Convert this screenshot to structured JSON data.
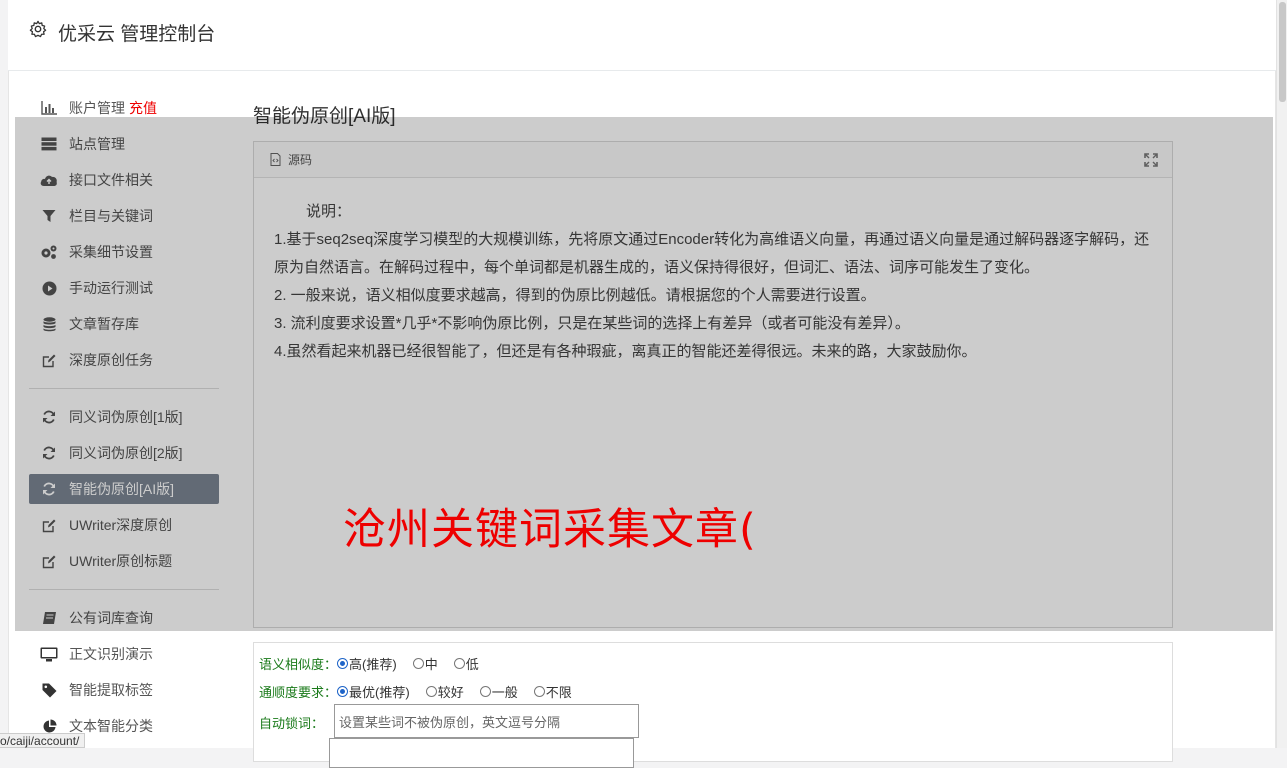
{
  "header": {
    "title": "优采云 管理控制台"
  },
  "sidebar": {
    "group1": [
      {
        "label": "账户管理",
        "badge": "充值",
        "icon": "bar-chart-icon"
      },
      {
        "label": "站点管理",
        "icon": "server-icon"
      },
      {
        "label": "接口文件相关",
        "icon": "cloud-upload-icon"
      },
      {
        "label": "栏目与关键词",
        "icon": "filter-icon"
      },
      {
        "label": "采集细节设置",
        "icon": "gears-icon"
      },
      {
        "label": "手动运行测试",
        "icon": "play-icon"
      },
      {
        "label": "文章暂存库",
        "icon": "database-icon"
      },
      {
        "label": "深度原创任务",
        "icon": "edit-icon"
      }
    ],
    "group2": [
      {
        "label": "同义词伪原创[1版]",
        "icon": "refresh-icon"
      },
      {
        "label": "同义词伪原创[2版]",
        "icon": "refresh-icon"
      },
      {
        "label": "智能伪原创[AI版]",
        "icon": "refresh-icon"
      },
      {
        "label": "UWriter深度原创",
        "icon": "edit-icon"
      },
      {
        "label": "UWriter原创标题",
        "icon": "edit-icon"
      }
    ],
    "group3": [
      {
        "label": "公有词库查询",
        "icon": "book-icon"
      },
      {
        "label": "正文识别演示",
        "icon": "desktop-icon"
      },
      {
        "label": "智能提取标签",
        "icon": "tag-icon"
      },
      {
        "label": "文本智能分类",
        "icon": "pie-chart-icon"
      }
    ]
  },
  "main": {
    "title": "智能伪原创[AI版]",
    "panel_label": "源码",
    "desc": {
      "heading": "说明：",
      "line1": "1.基于seq2seq深度学习模型的大规模训练，先将原文通过Encoder转化为高维语义向量，再通过语义向量是通过解码器逐字解码，还原为自然语言。在解码过程中，每个单词都是机器生成的，语义保持得很好，但词汇、语法、词序可能发生了变化。",
      "line2": "2. 一般来说，语义相似度要求越高，得到的伪原比例越低。请根据您的个人需要进行设置。",
      "line3": "3. 流利度要求设置*几乎*不影响伪原比例，只是在某些词的选择上有差异（或者可能没有差异）。",
      "line4": "4.虽然看起来机器已经很智能了，但还是有各种瑕疵，离真正的智能还差得很远。未来的路，大家鼓励你。"
    }
  },
  "overlay_text": "沧州关键词采集文章(",
  "form": {
    "similarity": {
      "label": "语义相似度：",
      "options": [
        "高(推荐)",
        "中",
        "低"
      ],
      "selected": "高(推荐)"
    },
    "fluency": {
      "label": "通顺度要求：",
      "options": [
        "最优(推荐)",
        "较好",
        "一般",
        "不限"
      ],
      "selected": "最优(推荐)"
    },
    "lock": {
      "label": "自动锁词：",
      "placeholder": "设置某些词不被伪原创，英文逗号分隔"
    }
  },
  "status_url": "o/caiji/account/"
}
